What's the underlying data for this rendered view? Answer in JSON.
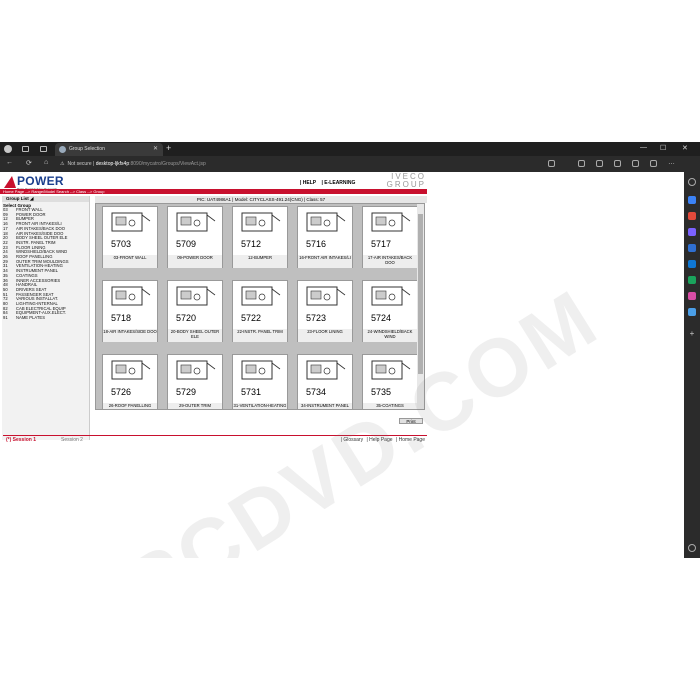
{
  "browser": {
    "tab_title": "Group Selection",
    "security_label": "Not secure",
    "url_host": "desktop-ljkfs4p",
    "url_path": ":8090/mycatro/Groups/ViewAct.jsp"
  },
  "app": {
    "logo_text": "POWER",
    "logo_tagline": "Parts On Web Easy Research",
    "help_label": "| HELP",
    "elearning_label": "| E-LEARNING",
    "brand_text": "IVECO GROUP",
    "breadcrumb": "Home Page --> Range/Model Search --> Class --> Group",
    "pic_info": "PIC: UAT4986A1 | Model: CITYCLASS-491.24(CNG) | Class: 57",
    "group_list_label": "Group List",
    "select_group_label": "Select Group",
    "print_label": "Print"
  },
  "groups": [
    {
      "num": "03",
      "name": "FRONT WALL"
    },
    {
      "num": "09",
      "name": "POWER DOOR"
    },
    {
      "num": "12",
      "name": "BUMPER"
    },
    {
      "num": "16",
      "name": "FRONT AIR INTAKES/LI"
    },
    {
      "num": "17",
      "name": "AIR INTAKES/BACK DOO"
    },
    {
      "num": "18",
      "name": "AIR INTAKES/SIDE DOO"
    },
    {
      "num": "20",
      "name": "BODY SHEEL OUTER ELE"
    },
    {
      "num": "22",
      "name": "INSTR. PANEL TRIM"
    },
    {
      "num": "23",
      "name": "FLOOR LINING"
    },
    {
      "num": "24",
      "name": "WINDSHIELD/BACK WIND"
    },
    {
      "num": "26",
      "name": "ROOF PANELLING"
    },
    {
      "num": "29",
      "name": "OUTER TRIM MOULDINGS"
    },
    {
      "num": "31",
      "name": "VENTILATION-HEATING"
    },
    {
      "num": "34",
      "name": "INSTRUMENT PANEL"
    },
    {
      "num": "35",
      "name": "COATINGS"
    },
    {
      "num": "36",
      "name": "INNER ACCESSORIES"
    },
    {
      "num": "48",
      "name": "HANDRAIL"
    },
    {
      "num": "50",
      "name": "DRIVERS SEAT"
    },
    {
      "num": "51",
      "name": "PASSENGER SEAT"
    },
    {
      "num": "72",
      "name": "VARIOUS INSTALLAT."
    },
    {
      "num": "80",
      "name": "LIGHTING-INTERNAL"
    },
    {
      "num": "82",
      "name": "CAB ELECTRICAL EQUIP"
    },
    {
      "num": "84",
      "name": "EQUIPMENT-AUX.ELECT."
    },
    {
      "num": "91",
      "name": "NAME PLATES"
    }
  ],
  "cards": [
    {
      "code": "5703",
      "caption": "03-FRONT WALL"
    },
    {
      "code": "5709",
      "caption": "09-POWER DOOR"
    },
    {
      "code": "5712",
      "caption": "12-BUMPER"
    },
    {
      "code": "5716",
      "caption": "16-FRONT AIR INTAKES/LI"
    },
    {
      "code": "5717",
      "caption": "17-AIR INTAKES/BACK DOO"
    },
    {
      "code": "5718",
      "caption": "18-AIR INTAKES/SIDE DOO"
    },
    {
      "code": "5720",
      "caption": "20-BODY SHEEL OUTER ELE"
    },
    {
      "code": "5722",
      "caption": "22-INSTR. PANEL TRIM"
    },
    {
      "code": "5723",
      "caption": "23-FLOOR LINING"
    },
    {
      "code": "5724",
      "caption": "24-WINDSHIELD/BACK WIND"
    },
    {
      "code": "5726",
      "caption": "26-ROOF PANELLING"
    },
    {
      "code": "5729",
      "caption": "29-OUTER TRIM MOULDINGS"
    },
    {
      "code": "5731",
      "caption": "31-VENTILATION-HEATING"
    },
    {
      "code": "5734",
      "caption": "34-INSTRUMENT PANEL"
    },
    {
      "code": "5735",
      "caption": "35-COATINGS"
    }
  ],
  "footer": {
    "session1": "(*) Session 1",
    "session2": "Session 2",
    "glossary": "| Glossary",
    "help_page": "| Help Page",
    "home_page": "| Home Page"
  },
  "watermark": "EPCDVD.COM",
  "colors": {
    "accent_red": "#c8102e",
    "logo_blue": "#1a3e8c"
  }
}
